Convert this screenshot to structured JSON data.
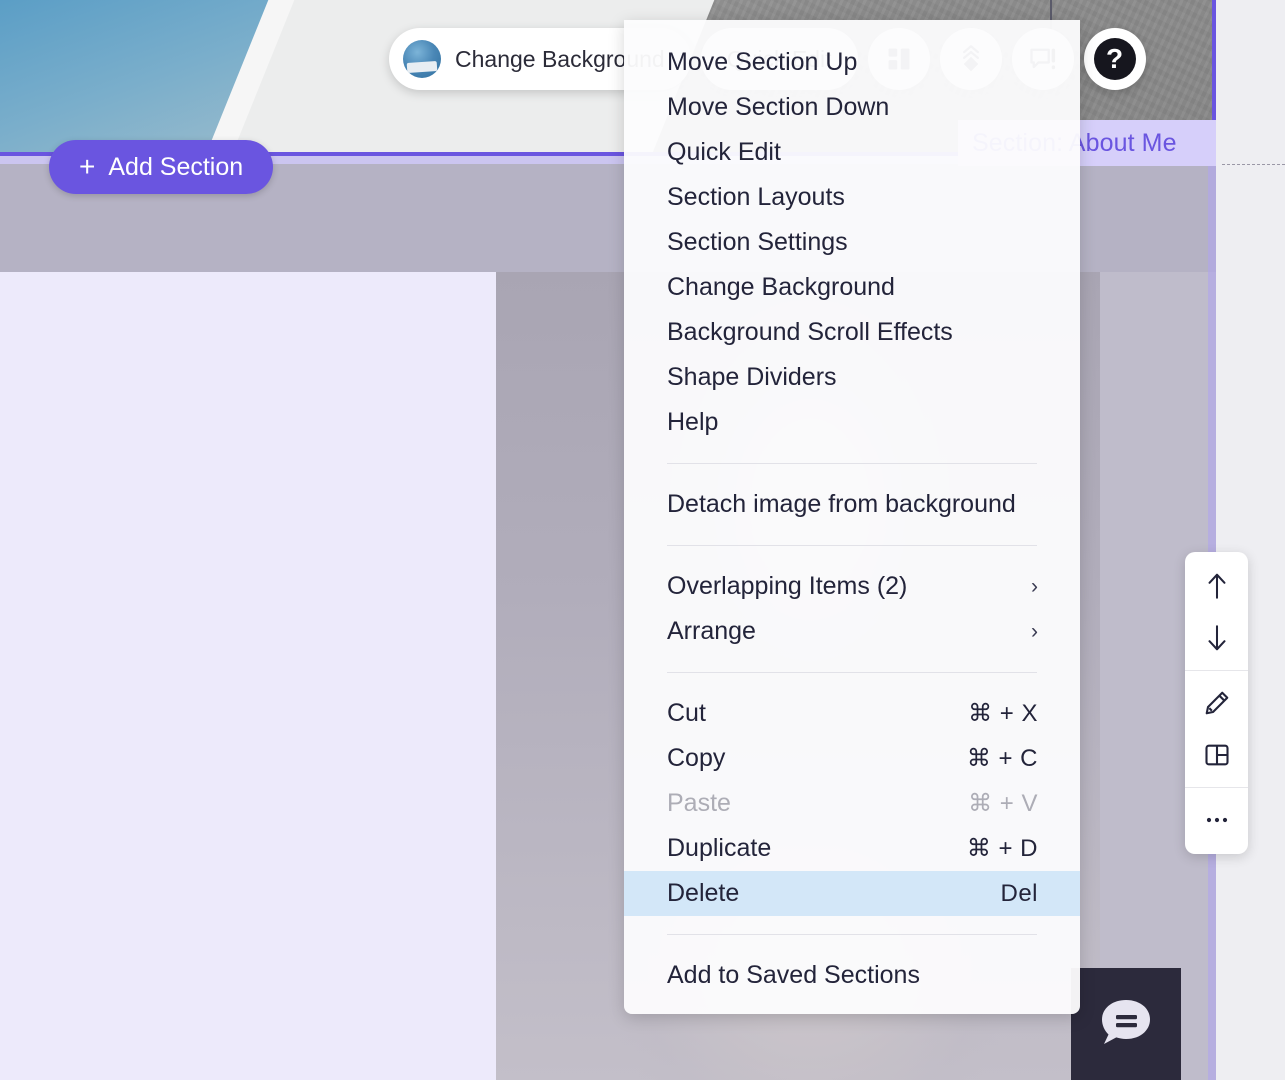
{
  "editor": {
    "section_badge": "Section: About Me",
    "add_section_label": "Add Section",
    "add_section_plus": "+",
    "toolbar": {
      "change_background_label": "Change Background",
      "quick_edit_label": "Quick Edit",
      "icons": [
        {
          "name": "layouts-icon"
        },
        {
          "name": "animation-icon"
        },
        {
          "name": "alert-tooltip-icon"
        }
      ],
      "help_label": "?"
    },
    "side_toolbar": {
      "items": [
        {
          "name": "move-up-icon"
        },
        {
          "name": "move-down-icon"
        },
        {
          "name": "edit-pencil-icon"
        },
        {
          "name": "layout-icon"
        },
        {
          "name": "more-options-icon"
        }
      ]
    },
    "chat": {
      "icon": "chat-bubble-icon"
    },
    "colors": {
      "accent_purple": "#6a55e0",
      "badge_bg": "#d6cffa",
      "highlight_blue": "#d3e7f8",
      "chat_bg": "#2c2a3c"
    }
  },
  "context_menu": {
    "groups": [
      {
        "items": [
          {
            "label": "Move Section Up",
            "shortcut": "",
            "state": "normal",
            "submenu": false
          },
          {
            "label": "Move Section Down",
            "shortcut": "",
            "state": "normal",
            "submenu": false
          },
          {
            "label": "Quick Edit",
            "shortcut": "",
            "state": "normal",
            "submenu": false
          },
          {
            "label": "Section Layouts",
            "shortcut": "",
            "state": "normal",
            "submenu": false
          },
          {
            "label": "Section Settings",
            "shortcut": "",
            "state": "normal",
            "submenu": false
          },
          {
            "label": "Change Background",
            "shortcut": "",
            "state": "normal",
            "submenu": false
          },
          {
            "label": "Background Scroll Effects",
            "shortcut": "",
            "state": "normal",
            "submenu": false
          },
          {
            "label": "Shape Dividers",
            "shortcut": "",
            "state": "normal",
            "submenu": false
          },
          {
            "label": "Help",
            "shortcut": "",
            "state": "normal",
            "submenu": false
          }
        ]
      },
      {
        "items": [
          {
            "label": "Detach image from background",
            "shortcut": "",
            "state": "normal",
            "submenu": false
          }
        ]
      },
      {
        "items": [
          {
            "label": "Overlapping Items (2)",
            "shortcut": "",
            "state": "normal",
            "submenu": true
          },
          {
            "label": "Arrange",
            "shortcut": "",
            "state": "normal",
            "submenu": true
          }
        ]
      },
      {
        "items": [
          {
            "label": "Cut",
            "shortcut": "⌘ + X",
            "state": "normal",
            "submenu": false
          },
          {
            "label": "Copy",
            "shortcut": "⌘ + C",
            "state": "normal",
            "submenu": false
          },
          {
            "label": "Paste",
            "shortcut": "⌘ + V",
            "state": "disabled",
            "submenu": false
          },
          {
            "label": "Duplicate",
            "shortcut": "⌘ + D",
            "state": "normal",
            "submenu": false
          },
          {
            "label": "Delete",
            "shortcut": "Del",
            "state": "highlight",
            "submenu": false
          }
        ]
      },
      {
        "items": [
          {
            "label": "Add to Saved Sections",
            "shortcut": "",
            "state": "normal",
            "submenu": false
          }
        ]
      }
    ]
  }
}
